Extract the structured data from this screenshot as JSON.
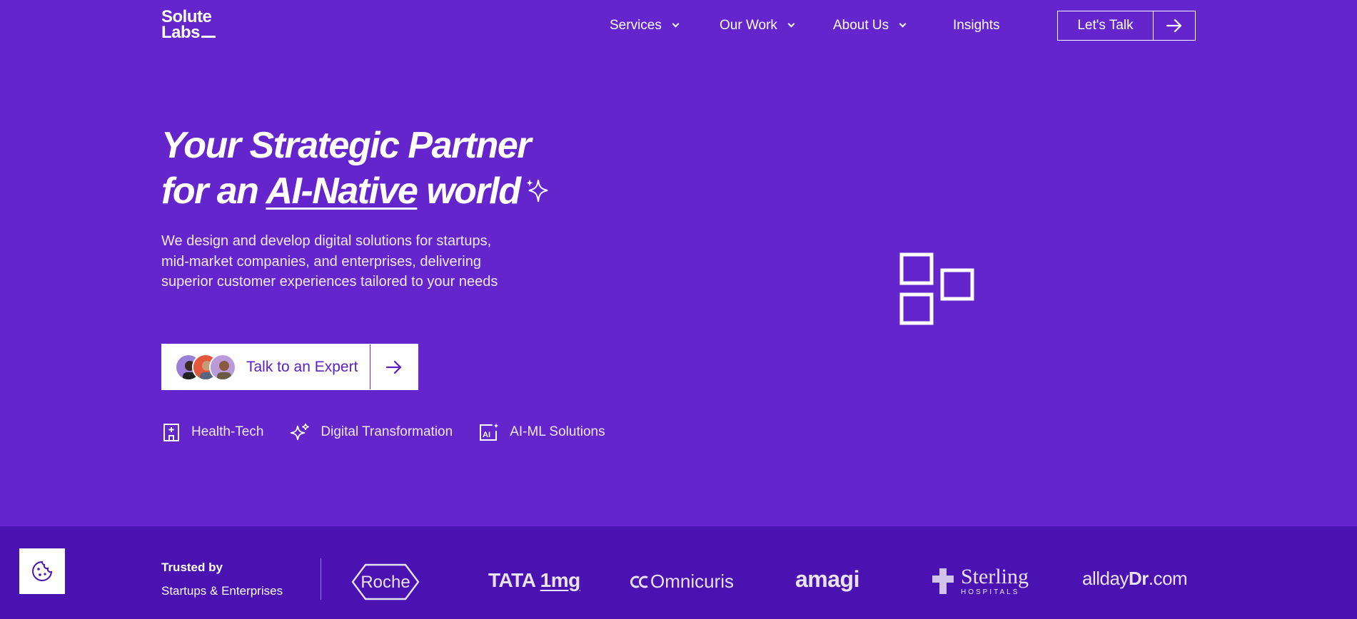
{
  "brand": {
    "logo_line1": "Solute",
    "logo_line2": "Labs"
  },
  "nav": {
    "items": [
      {
        "label": "Services",
        "has_dropdown": true
      },
      {
        "label": "Our Work",
        "has_dropdown": true
      },
      {
        "label": "About Us",
        "has_dropdown": true
      },
      {
        "label": "Insights",
        "has_dropdown": false
      }
    ],
    "cta_label": "Let's Talk"
  },
  "hero": {
    "headline_line1": "Your Strategic Partner",
    "headline_line2_pre": "for an ",
    "headline_highlight": "AI-Native",
    "headline_line2_post": " world",
    "description": "We design and develop digital solutions for startups, mid-market companies, and enterprises, delivering superior customer experiences tailored to your needs",
    "cta_label": "Talk to an Expert",
    "tags": [
      {
        "label": "Health-Tech",
        "icon": "hospital-icon"
      },
      {
        "label": "Digital Transformation",
        "icon": "sparkles-icon"
      },
      {
        "label": "AI-ML Solutions",
        "icon": "ai-icon"
      }
    ]
  },
  "trusted": {
    "title": "Trusted by",
    "subtitle": "Startups & Enterprises",
    "logos": {
      "roche": "Roche",
      "tata_part1": "TATA",
      "tata_part2": "1mg",
      "omnicuris": "Omnicuris",
      "amagi": "amagi",
      "sterling": "Sterling",
      "sterling_sub": "HOSPITALS",
      "allday_part1": "allday",
      "allday_part2": "Dr",
      "allday_part3": ".com"
    }
  },
  "colors": {
    "background": "#6525cc",
    "trusted_bar": "#4a12b0",
    "cta_text": "#5a20c4"
  }
}
